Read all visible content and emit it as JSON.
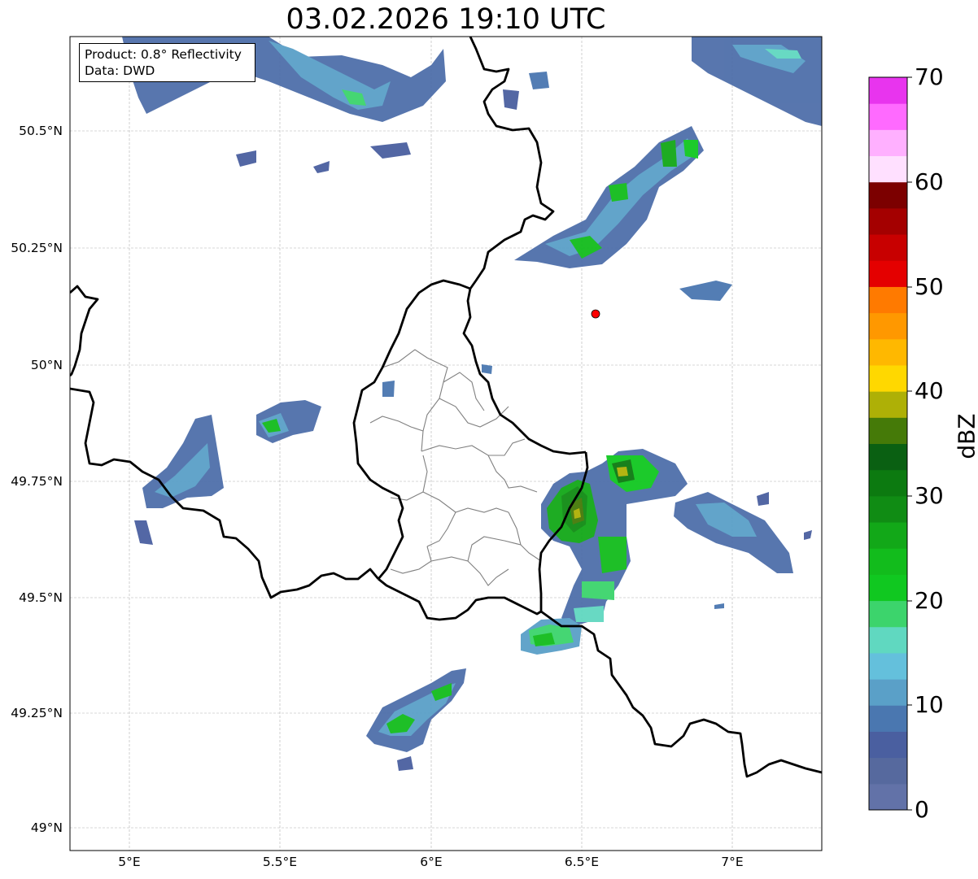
{
  "title": "03.02.2026 19:10 UTC",
  "info": {
    "product": "Product: 0.8° Reflectivity",
    "data": "Data: DWD"
  },
  "map": {
    "lon_range": [
      4.8,
      7.3
    ],
    "lat_range": [
      48.95,
      50.7
    ],
    "lat_ticks": [
      "50.5°N",
      "50.25°N",
      "50°N",
      "49.75°N",
      "49.5°N",
      "49.25°N",
      "49°N"
    ],
    "lon_ticks": [
      "5°E",
      "5.5°E",
      "6°E",
      "6.5°E",
      "7°E"
    ],
    "radar_site_marker": {
      "lon": 6.55,
      "lat": 50.11,
      "color": "#ff0000"
    },
    "grid": true
  },
  "colorbar": {
    "label": "dBZ",
    "range": [
      0,
      70
    ],
    "ticks": [
      "0",
      "10",
      "20",
      "30",
      "40",
      "50",
      "60",
      "70"
    ],
    "colors": [
      "#6272a8",
      "#56699e",
      "#4a5fa0",
      "#4a77b0",
      "#5aa0c8",
      "#64c0dc",
      "#60d8c0",
      "#3cd46c",
      "#10c820",
      "#12bc1c",
      "#12a818",
      "#108c14",
      "#0c7a10",
      "#0a6012",
      "#457a08",
      "#aeb006",
      "#ffd800",
      "#ffb800",
      "#ff9800",
      "#ff7a00",
      "#e40000",
      "#c80000",
      "#a40000",
      "#7c0000",
      "#ffe0ff",
      "#ffb0ff",
      "#ff6aff",
      "#e834ee"
    ]
  },
  "colors": {
    "borders": "#000000",
    "districts": "#808080",
    "grid": "#b0b0b0"
  }
}
